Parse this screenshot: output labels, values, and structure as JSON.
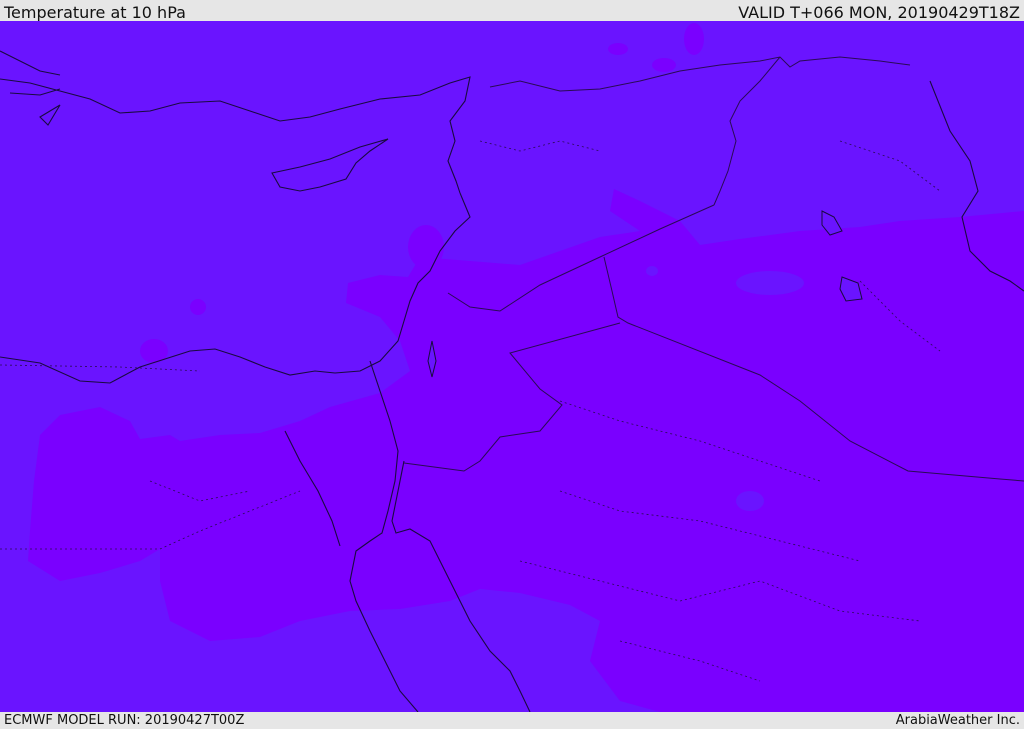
{
  "header": {
    "title": "Temperature at 10 hPa",
    "valid_time": "VALID T+066 MON, 20190429T18Z"
  },
  "footer": {
    "model_run": "ECMWF MODEL RUN: 20190427T00Z",
    "credit": "ArabiaWeather Inc."
  },
  "map": {
    "colors": {
      "cool_fill": "#6a14ff",
      "warm_fill": "#7a00ff",
      "coastline": "#1a0a40",
      "border": "#2a0a55"
    }
  }
}
